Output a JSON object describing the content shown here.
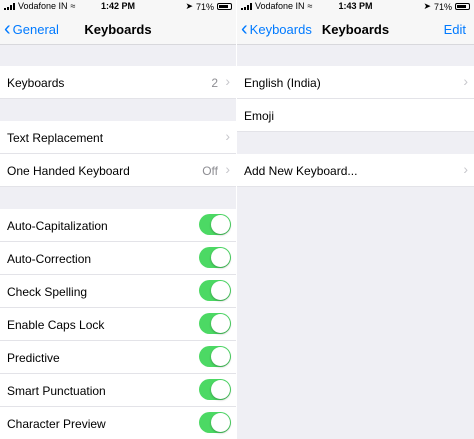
{
  "left": {
    "status": {
      "carrier": "Vodafone IN",
      "time": "1:42 PM",
      "battery": "71%"
    },
    "nav": {
      "back_label": "General",
      "title": "Keyboards"
    },
    "keyboards_row": {
      "label": "Keyboards",
      "value": "2"
    },
    "text_replacement": {
      "label": "Text Replacement"
    },
    "one_handed": {
      "label": "One Handed Keyboard",
      "value": "Off"
    },
    "toggles": [
      {
        "label": "Auto-Capitalization",
        "on": true
      },
      {
        "label": "Auto-Correction",
        "on": true
      },
      {
        "label": "Check Spelling",
        "on": true
      },
      {
        "label": "Enable Caps Lock",
        "on": true
      },
      {
        "label": "Predictive",
        "on": true
      },
      {
        "label": "Smart Punctuation",
        "on": true
      },
      {
        "label": "Character Preview",
        "on": true
      }
    ]
  },
  "right": {
    "status": {
      "carrier": "Vodafone IN",
      "time": "1:43 PM",
      "battery": "71%"
    },
    "nav": {
      "back_label": "Keyboards",
      "title": "Keyboards",
      "action_label": "Edit"
    },
    "keyboards": [
      {
        "label": "English (India)",
        "chevron": true
      },
      {
        "label": "Emoji",
        "chevron": false
      }
    ],
    "add_new": {
      "label": "Add New Keyboard..."
    }
  },
  "colors": {
    "accent": "#007aff",
    "toggle_on": "#4cd964",
    "background": "#efeff4"
  },
  "icons": {
    "back": "chevron-left-icon",
    "disclosure": "chevron-right-icon",
    "wifi": "wifi-icon",
    "signal": "signal-icon",
    "battery": "battery-icon",
    "location": "location-icon"
  }
}
